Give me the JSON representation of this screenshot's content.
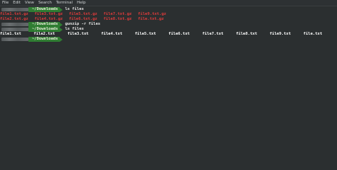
{
  "menu": [
    "File",
    "Edit",
    "View",
    "Search",
    "Terminal",
    "Help"
  ],
  "prompt_dir": "~/Downloads",
  "colors": {
    "background": "#2b2f30",
    "prompt_green": "#2f7d32",
    "archive_red": "#e03b3b",
    "text": "#e6e6e6"
  },
  "lines": [
    {
      "type": "prompt",
      "command": "ls files"
    },
    {
      "type": "files",
      "color": "red",
      "items": [
        "file1.txt.gz",
        "file3.txt.gz",
        "file5.txt.gz",
        "file7.txt.gz",
        "file9.txt.gz"
      ]
    },
    {
      "type": "files",
      "color": "red",
      "items": [
        "file2.txt.gz",
        "file4.txt.gz",
        "file6.txt.gz",
        "file8.txt.gz",
        "file.txt.gz"
      ]
    },
    {
      "type": "prompt",
      "command": "gunzip -r files"
    },
    {
      "type": "prompt",
      "command": "ls files"
    },
    {
      "type": "files",
      "color": "white",
      "items": [
        "file1.txt",
        "file2.txt",
        "file3.txt",
        "file4.txt",
        "file5.txt",
        "file6.txt",
        "file7.txt",
        "file8.txt",
        "file9.txt",
        "file.txt"
      ]
    },
    {
      "type": "prompt",
      "command": ""
    }
  ]
}
